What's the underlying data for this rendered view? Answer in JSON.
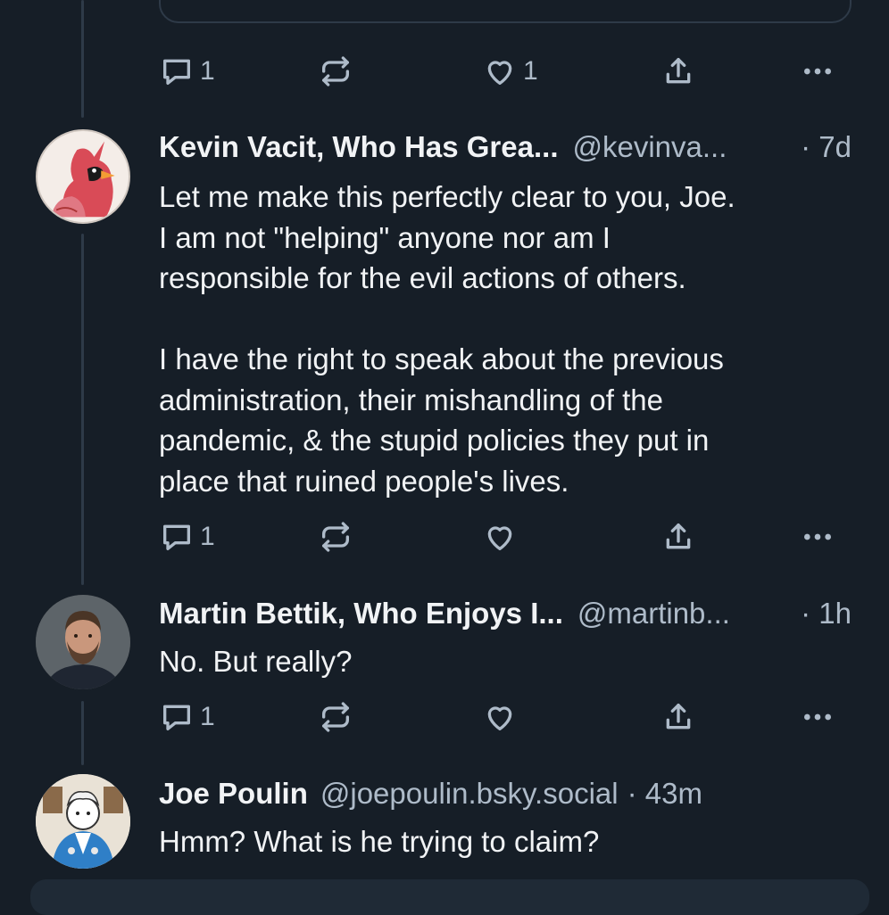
{
  "top_post": {
    "actions": {
      "reply_count": "1",
      "repost_count": "",
      "like_count": "1"
    }
  },
  "posts": [
    {
      "author_name": "Kevin Vacit, Who Has Grea...",
      "handle": "@kevinva...",
      "time": "· 7d",
      "avatar": "cardinal-bird-avatar",
      "body": "Let me make this perfectly clear to you, Joe.\nI am not \"helping\" anyone nor am I\nresponsible for the evil actions of others.\n\nI have the right to speak about the previous\nadministration, their mishandling of the\npandemic, & the stupid policies they put in\nplace that ruined people's lives.",
      "actions": {
        "reply_count": "1",
        "repost_count": "",
        "like_count": ""
      }
    },
    {
      "author_name": "Martin Bettik, Who Enjoys I...",
      "handle": "@martinb...",
      "time": "· 1h",
      "avatar": "bearded-man-photo-avatar",
      "body": "No. But really?",
      "actions": {
        "reply_count": "1",
        "repost_count": "",
        "like_count": ""
      }
    },
    {
      "author_name": "Joe Poulin",
      "handle": "@joepoulin.bsky.social",
      "time": "· 43m",
      "avatar": "illustrated-character-avatar",
      "body": "Hmm? What is he trying to claim?"
    }
  ],
  "colors": {
    "background": "#161e27",
    "text": "#f1f3f5",
    "muted": "#aebbc9",
    "thread_line": "#2e3a48"
  }
}
